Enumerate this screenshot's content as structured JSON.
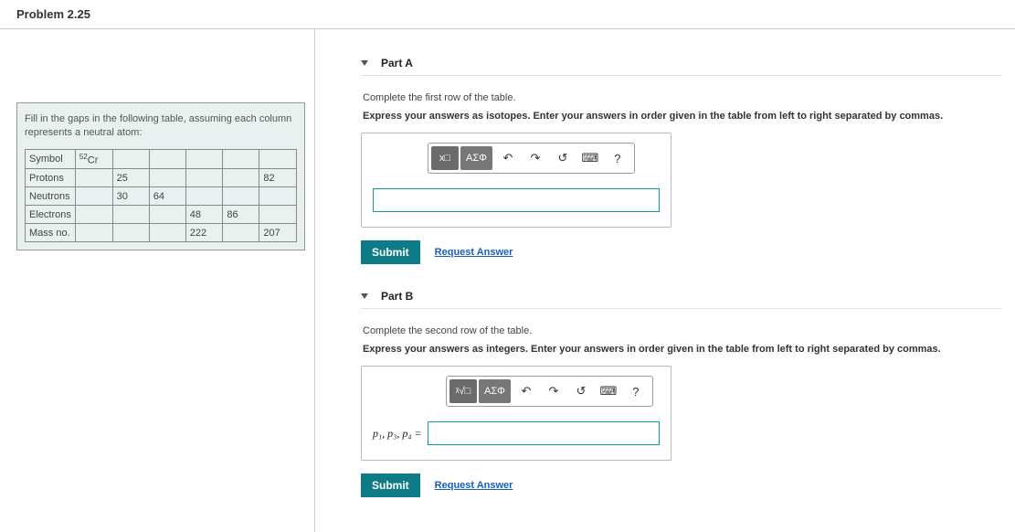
{
  "header": {
    "title": "Problem 2.25"
  },
  "left": {
    "prompt": "Fill in the gaps in the following table, assuming each column represents a neutral atom:",
    "table": {
      "rows": [
        {
          "label": "Symbol",
          "cells": [
            "52Cr",
            "",
            "",
            "",
            "",
            ""
          ]
        },
        {
          "label": "Protons",
          "cells": [
            "",
            "25",
            "",
            "",
            "",
            "82"
          ]
        },
        {
          "label": "Neutrons",
          "cells": [
            "",
            "30",
            "64",
            "",
            "",
            ""
          ]
        },
        {
          "label": "Electrons",
          "cells": [
            "",
            "",
            "",
            "48",
            "86",
            ""
          ]
        },
        {
          "label": "Mass no.",
          "cells": [
            "",
            "",
            "",
            "222",
            "",
            "207"
          ]
        }
      ],
      "symbol_display": {
        "sup": "52",
        "el": "Cr"
      }
    }
  },
  "parts": {
    "a": {
      "title": "Part A",
      "instruction1": "Complete the first row of the table.",
      "instruction2": "Express your answers as isotopes. Enter your answers in order given in the table from left to right separated by commas.",
      "toolbar": {
        "template": "x□",
        "greek": "ΑΣΦ",
        "undo": "↶",
        "redo": "↷",
        "reset": "↺",
        "keyboard": "⌨",
        "help": "?"
      },
      "answer_label": "",
      "submit": "Submit",
      "request": "Request Answer"
    },
    "b": {
      "title": "Part B",
      "instruction1": "Complete the second row of the table.",
      "instruction2": "Express your answers as integers. Enter your answers in order given in the table from left to right separated by commas.",
      "toolbar": {
        "template": "ᵡ√□",
        "greek": "ΑΣΦ",
        "undo": "↶",
        "redo": "↷",
        "reset": "↺",
        "keyboard": "⌨",
        "help": "?"
      },
      "answer_label": "p₁, p₃, p₄ =",
      "submit": "Submit",
      "request": "Request Answer"
    }
  }
}
